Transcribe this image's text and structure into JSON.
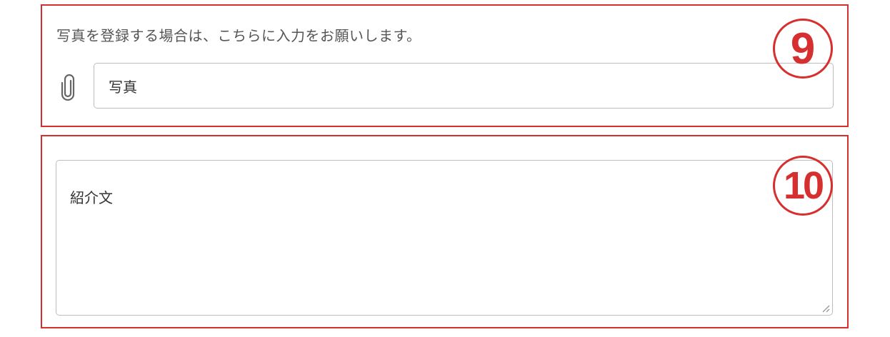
{
  "photo_section": {
    "helper_text": "写真を登録する場合は、こちらに入力をお願いします。",
    "file_input_placeholder": "写真",
    "clip_icon": "paperclip-icon",
    "badge": "9"
  },
  "intro_section": {
    "textarea_placeholder": "紹介文",
    "badge": "10"
  },
  "colors": {
    "annotation_red": "#d62f2f",
    "input_border": "#bdbdbd",
    "text": "#333333"
  }
}
